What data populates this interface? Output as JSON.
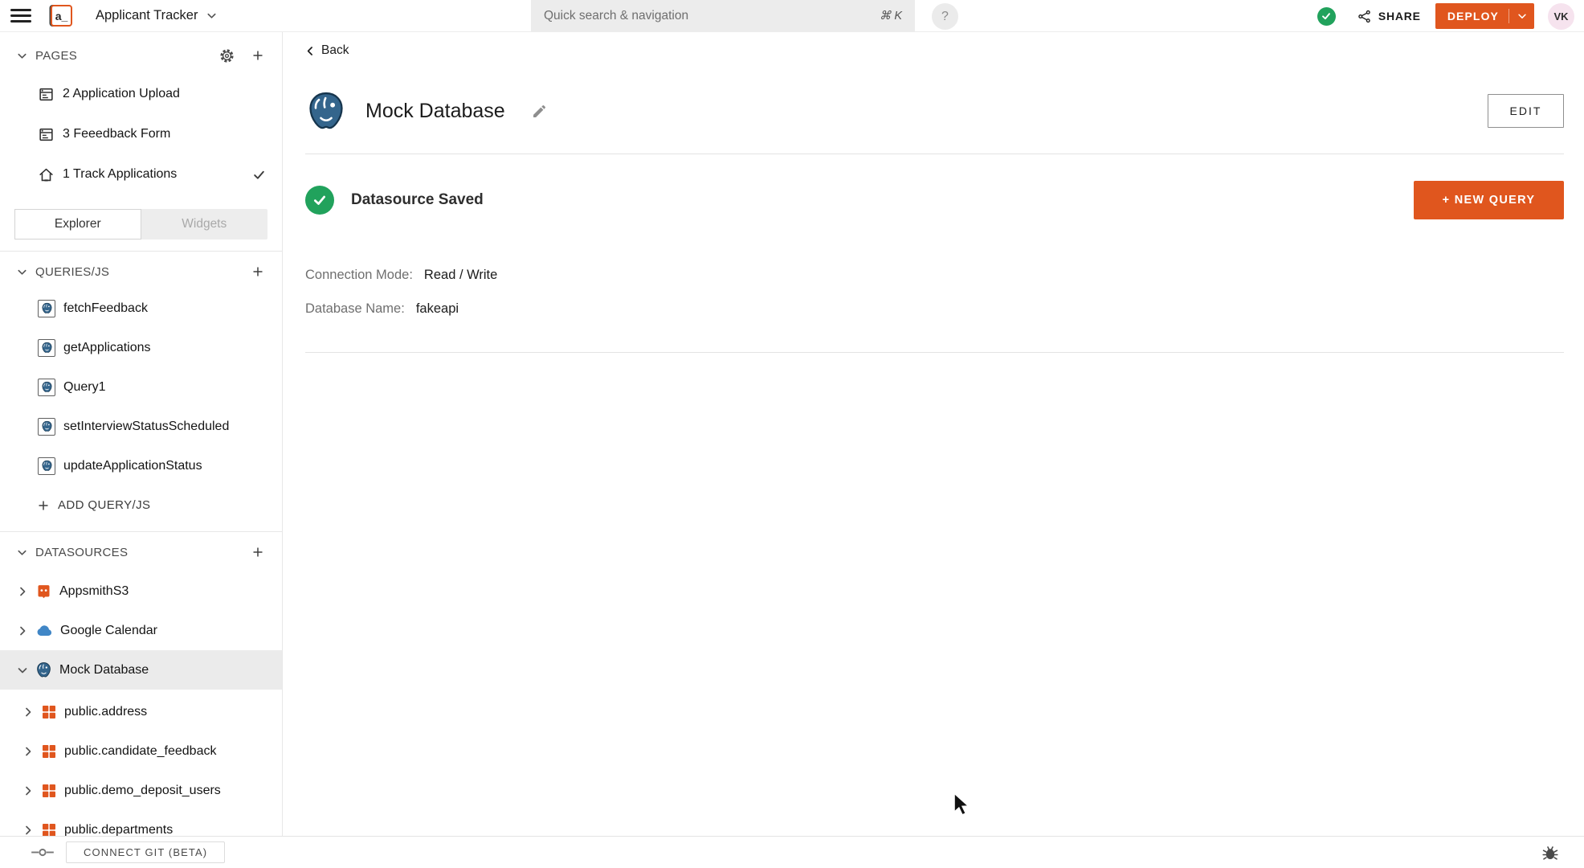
{
  "topbar": {
    "logo_text": "a_",
    "app_title": "Applicant Tracker",
    "search_placeholder": "Quick search & navigation",
    "search_shortcut": "⌘ K",
    "help_label": "?",
    "share_label": "SHARE",
    "deploy_label": "DEPLOY",
    "avatar_initials": "VK"
  },
  "sidebar": {
    "pages_header": "PAGES",
    "pages": [
      {
        "label": "2 Application Upload"
      },
      {
        "label": "3 Feeedback Form"
      },
      {
        "label": "1 Track Applications"
      }
    ],
    "tabs": {
      "explorer": "Explorer",
      "widgets": "Widgets"
    },
    "queries_header": "QUERIES/JS",
    "queries": [
      "fetchFeedback",
      "getApplications",
      "Query1",
      "setInterviewStatusScheduled",
      "updateApplicationStatus"
    ],
    "add_query_label": "ADD QUERY/JS",
    "datasources_header": "DATASOURCES",
    "datasources": [
      {
        "label": "AppsmithS3"
      },
      {
        "label": "Google Calendar"
      },
      {
        "label": "Mock Database"
      }
    ],
    "tables": [
      "public.address",
      "public.candidate_feedback",
      "public.demo_deposit_users",
      "public.departments"
    ]
  },
  "main": {
    "back_label": "Back",
    "title": "Mock Database",
    "edit_button_label": "EDIT",
    "status_label": "Datasource Saved",
    "new_query_label": "+ NEW QUERY",
    "connection_mode_label": "Connection Mode:",
    "connection_mode_value": "Read / Write",
    "database_name_label": "Database Name:",
    "database_name_value": "fakeapi"
  },
  "footer": {
    "connect_git_label": "CONNECT GIT (BETA)"
  },
  "colors": {
    "accent_orange": "#E0561E",
    "success_green": "#21A25C",
    "postgres_blue": "#34658C",
    "calendar_blue": "#4086C6"
  }
}
